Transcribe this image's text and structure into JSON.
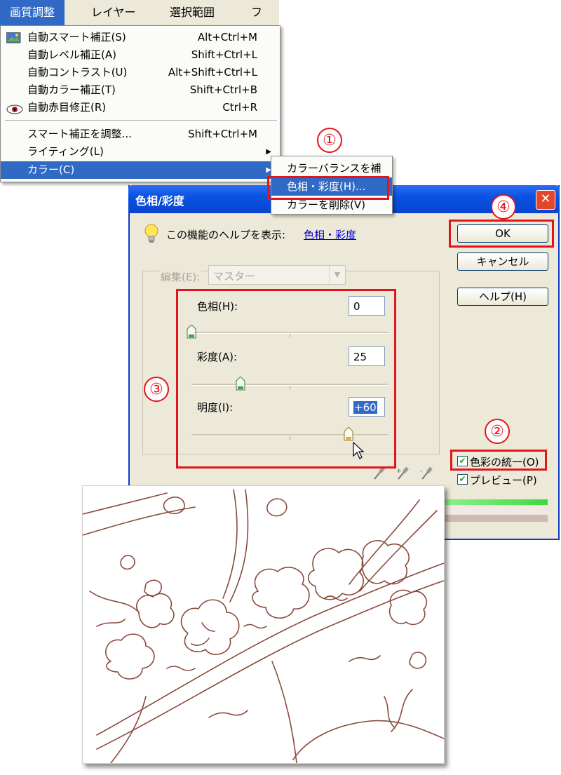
{
  "menubar": {
    "items": [
      "画質調整",
      "レイヤー",
      "選択範囲",
      "フィル"
    ]
  },
  "menu": {
    "items": [
      {
        "label": "自動スマート補正(S)",
        "shortcut": "Alt+Ctrl+M"
      },
      {
        "label": "自動レベル補正(A)",
        "shortcut": "Shift+Ctrl+L"
      },
      {
        "label": "自動コントラスト(U)",
        "shortcut": "Alt+Shift+Ctrl+L"
      },
      {
        "label": "自動カラー補正(T)",
        "shortcut": "Shift+Ctrl+B"
      },
      {
        "label": "自動赤目修正(R)",
        "shortcut": "Ctrl+R"
      },
      {
        "label": "スマート補正を調整...",
        "shortcut": "Shift+Ctrl+M"
      },
      {
        "label": "ライティング(L)",
        "shortcut": ""
      },
      {
        "label": "カラー(C)",
        "shortcut": ""
      }
    ],
    "submenu": [
      "カラーバランスを補",
      "色相・彩度(H)...",
      "カラーを削除(V)"
    ]
  },
  "dialog": {
    "title": "色相/彩度",
    "help_text": "この機能のヘルプを表示:",
    "help_link": "色相・彩度",
    "edit_label": "編集(E):",
    "edit_value": "マスター",
    "ok_label": "OK",
    "cancel_label": "キャンセル",
    "help_button": "ヘルプ(H)",
    "hue_label": "色相(H):",
    "hue_value": "0",
    "hue_level": 0.0,
    "saturation_label": "彩度(A):",
    "saturation_value": "25",
    "saturation_level": 0.25,
    "lightness_label": "明度(I):",
    "lightness_value": "+60",
    "lightness_level": 0.8,
    "colorize_label": "色彩の統一(O)",
    "preview_label": "プレビュー(P)",
    "colorize_checked": true,
    "preview_checked": true
  },
  "annotations": {
    "step1": "①",
    "step2": "②",
    "step3": "③",
    "step4": "④"
  },
  "colors": {
    "accent": "#316ac5",
    "annotation_red": "#e4141b",
    "titlebar": "#0a53e2",
    "line_art": "#8a4a3c"
  }
}
